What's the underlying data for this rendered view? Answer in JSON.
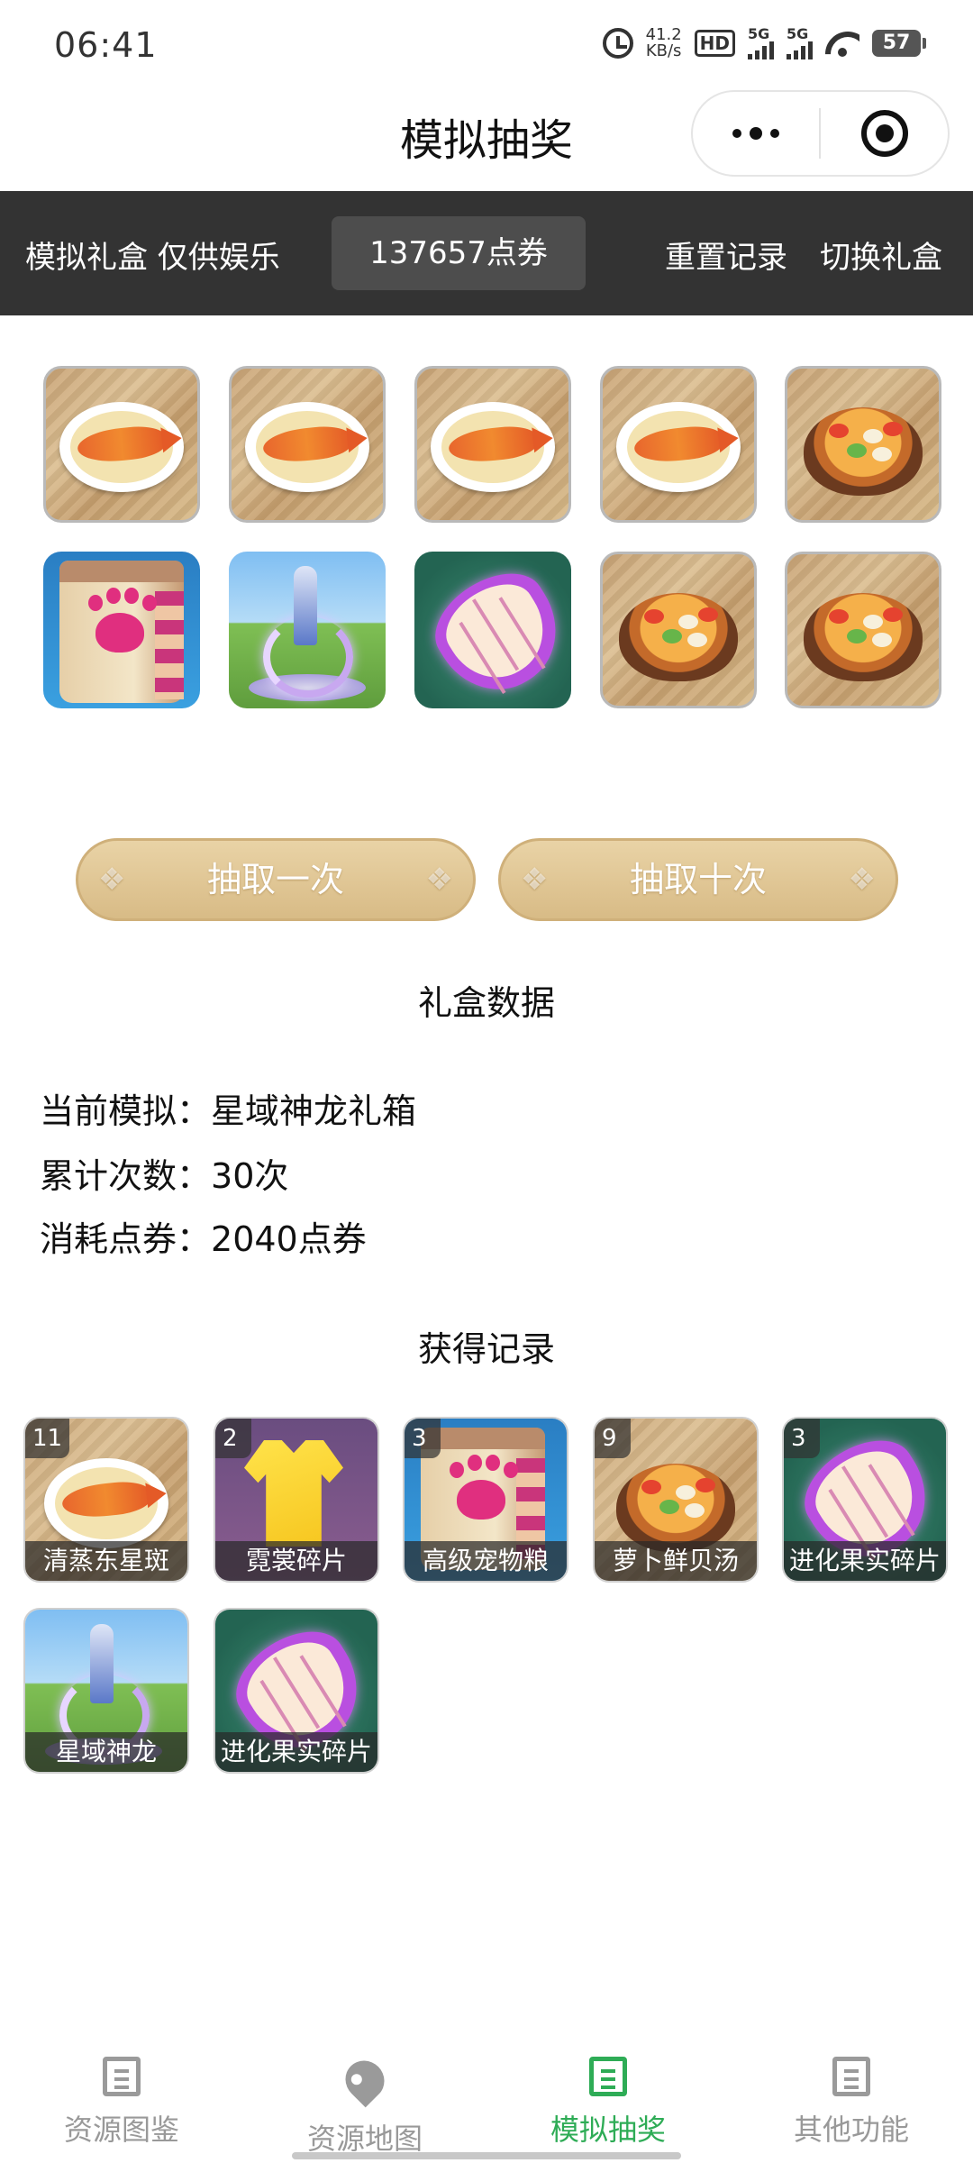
{
  "status_bar": {
    "time": "06:41",
    "net_speed_value": "41.2",
    "net_speed_unit": "KB/s",
    "hd_label": "HD",
    "sim1_label": "5G",
    "sim2_label": "5G",
    "battery": "57"
  },
  "title_bar": {
    "title": "模拟抽奖"
  },
  "toolbar": {
    "label": "模拟礼盒 仅供娱乐",
    "points": "137657点券",
    "reset_label": "重置记录",
    "switch_label": "切换礼盒"
  },
  "draw_buttons": {
    "once": "抽取一次",
    "ten": "抽取十次"
  },
  "box_data": {
    "heading": "礼盒数据",
    "current_label": "当前模拟：",
    "current_value": "星域神龙礼箱",
    "count_label": "累计次数：",
    "count_value": "30次",
    "cost_label": "消耗点券：",
    "cost_value": "2040点券"
  },
  "history": {
    "heading": "获得记录",
    "items": [
      {
        "count": "11",
        "name": "清蒸东星斑"
      },
      {
        "count": "2",
        "name": "霓裳碎片"
      },
      {
        "count": "3",
        "name": "高级宠物粮"
      },
      {
        "count": "9",
        "name": "萝卜鲜贝汤"
      },
      {
        "count": "3",
        "name": "进化果实碎片"
      },
      {
        "count": "",
        "name": "星域神龙"
      },
      {
        "count": "",
        "name": "进化果实碎片"
      }
    ]
  },
  "tab_bar": {
    "tabs": [
      {
        "label": "资源图鉴",
        "icon": "document-icon"
      },
      {
        "label": "资源地图",
        "icon": "map-pin-icon"
      },
      {
        "label": "模拟抽奖",
        "icon": "document-icon",
        "active": true
      },
      {
        "label": "其他功能",
        "icon": "document-icon"
      }
    ]
  },
  "colors": {
    "accent_green": "#2eac56",
    "dark_bar": "#333333",
    "button_gold": "#d8bb86"
  }
}
